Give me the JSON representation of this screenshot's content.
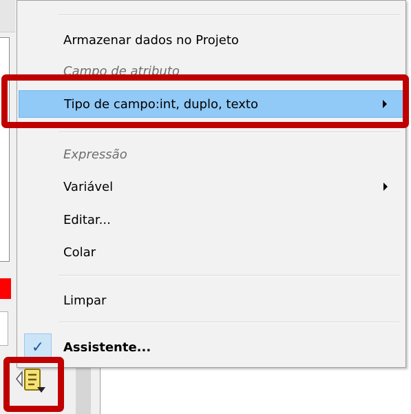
{
  "menu": {
    "items": [
      {
        "label": "Armazenar dados no Projeto"
      },
      {
        "label": "Campo de atributo"
      },
      {
        "label": "Tipo de campo:int, duplo, texto"
      },
      {
        "label": "Expressão"
      },
      {
        "label": "Variável"
      },
      {
        "label": "Editar..."
      },
      {
        "label": "Colar"
      },
      {
        "label": "Limpar"
      },
      {
        "label": "Assistente..."
      }
    ]
  },
  "icons": {
    "check": "checkmark-icon",
    "submenu": "chevron-right-icon",
    "tool": "data-defined-override-icon"
  },
  "colors": {
    "highlight": "#91c9f7",
    "annotation": "#c00000",
    "menu_background": "#f2f2f2"
  }
}
